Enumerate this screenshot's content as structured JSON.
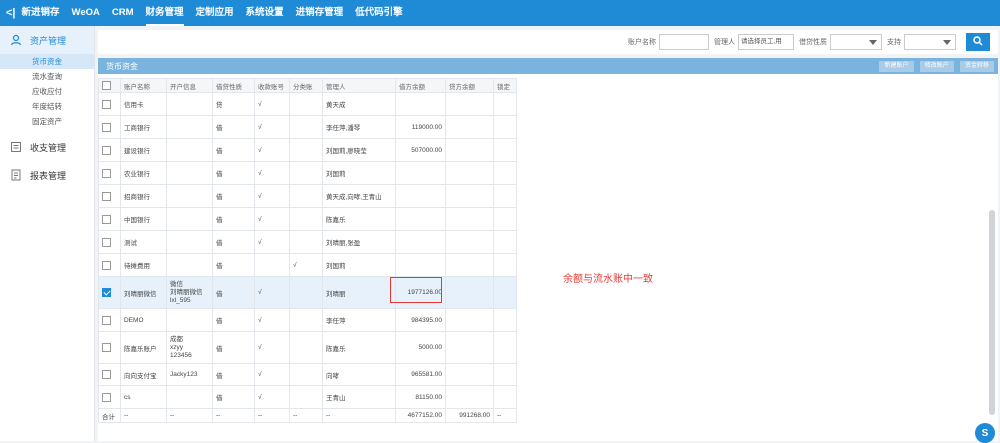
{
  "topnav": {
    "back": "<|",
    "items": [
      "新进销存",
      "WeOA",
      "CRM",
      "财务管理",
      "定制应用",
      "系统设置",
      "进销存管理",
      "低代码引擎"
    ],
    "active_index": 3
  },
  "sidebar": {
    "groups": [
      {
        "label": "资产管理",
        "icon": "user-icon",
        "active": true
      },
      {
        "label": "收支管理",
        "icon": "ledger-icon",
        "active": false
      },
      {
        "label": "报表管理",
        "icon": "report-icon",
        "active": false
      }
    ],
    "subitems": [
      "货币资金",
      "流水查询",
      "应收应付",
      "年度结转",
      "固定资产"
    ],
    "active_subitem": 0
  },
  "filters": {
    "account_name_label": "账户名称",
    "account_name_value": "",
    "manager_label": "管理人",
    "manager_placeholder": "请选择员工,用",
    "debit_credit_label": "借贷性质",
    "support_label": "支持"
  },
  "panel": {
    "title": "货币资金",
    "buttons": [
      "新建账户",
      "修改账户",
      "资金转移"
    ]
  },
  "table": {
    "headers": [
      "",
      "账户名称",
      "开户信息",
      "借贷性质",
      "收款账号",
      "分类账",
      "管理人",
      "借方余额",
      "贷方余额",
      "锁定"
    ],
    "rows": [
      {
        "checked": false,
        "name": "信用卡",
        "info": [],
        "nature": "贷",
        "receive": "√",
        "ledger": "",
        "manager": "黄天成",
        "debit": "",
        "credit": "",
        "lock": ""
      },
      {
        "checked": false,
        "name": "工商银行",
        "info": [],
        "nature": "借",
        "receive": "√",
        "ledger": "",
        "manager": "李任萍,潘琴",
        "debit": "119000.00",
        "credit": "",
        "lock": ""
      },
      {
        "checked": false,
        "name": "建设银行",
        "info": [],
        "nature": "借",
        "receive": "√",
        "ledger": "",
        "manager": "刘国莉,廖晓莹",
        "debit": "507000.00",
        "credit": "",
        "lock": ""
      },
      {
        "checked": false,
        "name": "农业银行",
        "info": [],
        "nature": "借",
        "receive": "√",
        "ledger": "",
        "manager": "刘国莉",
        "debit": "",
        "credit": "",
        "lock": ""
      },
      {
        "checked": false,
        "name": "招商银行",
        "info": [],
        "nature": "借",
        "receive": "√",
        "ledger": "",
        "manager": "黄天成,向哮,王青山",
        "debit": "",
        "credit": "",
        "lock": ""
      },
      {
        "checked": false,
        "name": "中国银行",
        "info": [],
        "nature": "借",
        "receive": "√",
        "ledger": "",
        "manager": "陈嘉乐",
        "debit": "",
        "credit": "",
        "lock": ""
      },
      {
        "checked": false,
        "name": "测试",
        "info": [],
        "nature": "借",
        "receive": "√",
        "ledger": "",
        "manager": "刘晴丽,张盈",
        "debit": "",
        "credit": "",
        "lock": ""
      },
      {
        "checked": false,
        "name": "待摊费用",
        "info": [],
        "nature": "借",
        "receive": "",
        "ledger": "√",
        "manager": "刘国莉",
        "debit": "",
        "credit": "",
        "lock": ""
      },
      {
        "checked": true,
        "name": "刘晴丽微信",
        "info": [
          "微信",
          "刘晴丽微信",
          "lxl_595"
        ],
        "nature": "借",
        "receive": "√",
        "ledger": "",
        "manager": "刘晴丽",
        "debit": "1977126.00",
        "credit": "",
        "lock": ""
      },
      {
        "checked": false,
        "name": "DEMO",
        "info": [],
        "nature": "借",
        "receive": "√",
        "ledger": "",
        "manager": "李任萍",
        "debit": "984395.00",
        "credit": "",
        "lock": ""
      },
      {
        "checked": false,
        "name": "陈嘉乐账户",
        "info": [
          "成都",
          "xzyy",
          "123456"
        ],
        "nature": "借",
        "receive": "√",
        "ledger": "",
        "manager": "陈嘉乐",
        "debit": "5000.00",
        "credit": "",
        "lock": ""
      },
      {
        "checked": false,
        "name": "向向支付宝",
        "info": [
          "Jacky123"
        ],
        "nature": "借",
        "receive": "√",
        "ledger": "",
        "manager": "向哮",
        "debit": "965581.00",
        "credit": "",
        "lock": ""
      },
      {
        "checked": false,
        "name": "cs",
        "info": [],
        "nature": "借",
        "receive": "√",
        "ledger": "",
        "manager": "王青山",
        "debit": "81150.00",
        "credit": "",
        "lock": ""
      }
    ],
    "total": {
      "label": "合计",
      "dash": "--",
      "debit": "4677152.00",
      "credit": "991268.00"
    }
  },
  "annotation": "余额与流水账中一致",
  "colors": {
    "primary": "#1f8ad6",
    "annotation": "#e53935"
  }
}
